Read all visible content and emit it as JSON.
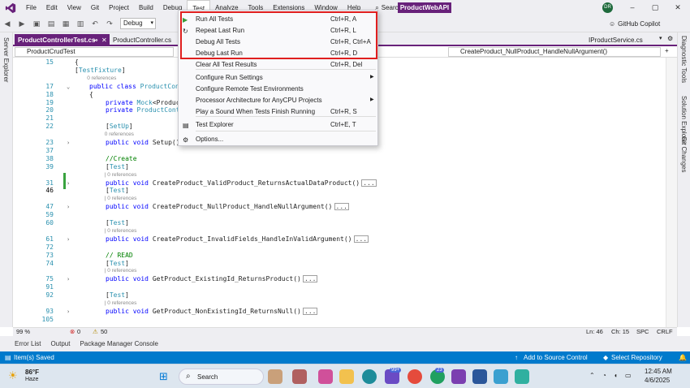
{
  "menubar": {
    "items": [
      "File",
      "Edit",
      "View",
      "Git",
      "Project",
      "Build",
      "Debug",
      "Test",
      "Analyze",
      "Tools",
      "Extensions",
      "Window",
      "Help"
    ],
    "search": "Search",
    "project": "ProductWebAPI",
    "avatar": "DR"
  },
  "toolbar": {
    "config": "Debug",
    "copilot": "GitHub Copilot"
  },
  "tabs": {
    "active": "ProductControllerTest.cs",
    "second": "ProductController.cs",
    "right": "IProductService.cs"
  },
  "nav": {
    "left": "ProductCrudTest",
    "right": "CreateProduct_NullProduct_HandleNullArgument()"
  },
  "rails": {
    "left": "Server Explorer",
    "right1": "Diagnostic Tools",
    "right2": "Solution Explorer",
    "right3": "Git Changes"
  },
  "dropdown": {
    "items": [
      {
        "label": "Run All Tests",
        "shortcut": "Ctrl+R, A",
        "icon": "run-icon"
      },
      {
        "label": "Repeat Last Run",
        "shortcut": "Ctrl+R, L",
        "icon": "repeat-icon"
      },
      {
        "label": "Debug All Tests",
        "shortcut": "Ctrl+R, Ctrl+A",
        "icon": ""
      },
      {
        "label": "Debug Last Run",
        "shortcut": "Ctrl+R, D",
        "icon": ""
      },
      {
        "label": "Clear All Test Results",
        "shortcut": "Ctrl+R, Del",
        "icon": ""
      },
      {
        "label": "Configure Run Settings",
        "shortcut": "",
        "icon": ""
      },
      {
        "label": "Configure Remote Test Environments",
        "shortcut": "",
        "icon": ""
      },
      {
        "label": "Processor Architecture for AnyCPU Projects",
        "shortcut": "",
        "icon": ""
      },
      {
        "label": "Play a Sound When Tests Finish Running",
        "shortcut": "Ctrl+R, S",
        "icon": ""
      },
      {
        "label": "Test Explorer",
        "shortcut": "Ctrl+E, T",
        "icon": "test-explorer-icon"
      },
      {
        "label": "Options...",
        "shortcut": "",
        "icon": "gear-icon"
      }
    ]
  },
  "code": {
    "lines": [
      {
        "n": "15",
        "t": "{"
      },
      {
        "n": "",
        "t": "[TestFixture]"
      },
      {
        "n": "",
        "t": "0 references",
        "ref": true
      },
      {
        "n": "17",
        "t": "public class ProductCon"
      },
      {
        "n": "18",
        "t": "{"
      },
      {
        "n": "19",
        "t": "private Mock<Produc"
      },
      {
        "n": "20",
        "t": "private ProductCont"
      },
      {
        "n": "21",
        "t": ""
      },
      {
        "n": "22",
        "t": "[SetUp]"
      },
      {
        "n": "",
        "t": "0 references",
        "ref": true
      },
      {
        "n": "23",
        "t": "public void Setup()"
      },
      {
        "n": "37",
        "t": ""
      },
      {
        "n": "38",
        "t": "//Create"
      },
      {
        "n": "39",
        "t": "[Test]"
      },
      {
        "n": "",
        "t": "| 0 references",
        "ref": true
      },
      {
        "n": "31",
        "t": "public void CreateProduct_ValidProduct_ReturnsActualDataProduct()"
      },
      {
        "n": "46",
        "t": "[Test]"
      },
      {
        "n": "",
        "t": "| 0 references",
        "ref": true
      },
      {
        "n": "47",
        "t": "public void CreateProduct_NullProduct_HandleNullArgument()"
      },
      {
        "n": "59",
        "t": ""
      },
      {
        "n": "60",
        "t": "[Test]"
      },
      {
        "n": "",
        "t": "| 0 references",
        "ref": true
      },
      {
        "n": "61",
        "t": "public void CreateProduct_InvalidFields_HandleInValidArgument()"
      },
      {
        "n": "72",
        "t": ""
      },
      {
        "n": "73",
        "t": "// READ"
      },
      {
        "n": "74",
        "t": "[Test]"
      },
      {
        "n": "",
        "t": "| 0 references",
        "ref": true
      },
      {
        "n": "75",
        "t": "public void GetProduct_ExistingId_ReturnsProduct()"
      },
      {
        "n": "91",
        "t": ""
      },
      {
        "n": "92",
        "t": "[Test]"
      },
      {
        "n": "",
        "t": "| 0 references",
        "ref": true
      },
      {
        "n": "93",
        "t": "public void GetProduct_NonExistingId_ReturnsNull()"
      },
      {
        "n": "105",
        "t": ""
      }
    ]
  },
  "editor_status": {
    "zoom": "99 %",
    "errors": "0",
    "warnings": "50",
    "ln": "Ln: 46",
    "ch": "Ch: 15",
    "spc": "SPC",
    "crlf": "CRLF"
  },
  "bottom_tabs": [
    "Error List",
    "Output",
    "Package Manager Console"
  ],
  "statusbar": {
    "left": "Item(s) Saved",
    "source": "Add to Source Control",
    "repo": "Select Repository"
  },
  "taskbar": {
    "temp": "86°F",
    "weather": "Haze",
    "search": "Search",
    "time": "12:45 AM",
    "date": "4/6/2025",
    "badge1": "99+",
    "badge2": "23"
  },
  "colors": {
    "accent": "#68217a",
    "status": "#007acc",
    "highlight": "#e01f1f"
  }
}
